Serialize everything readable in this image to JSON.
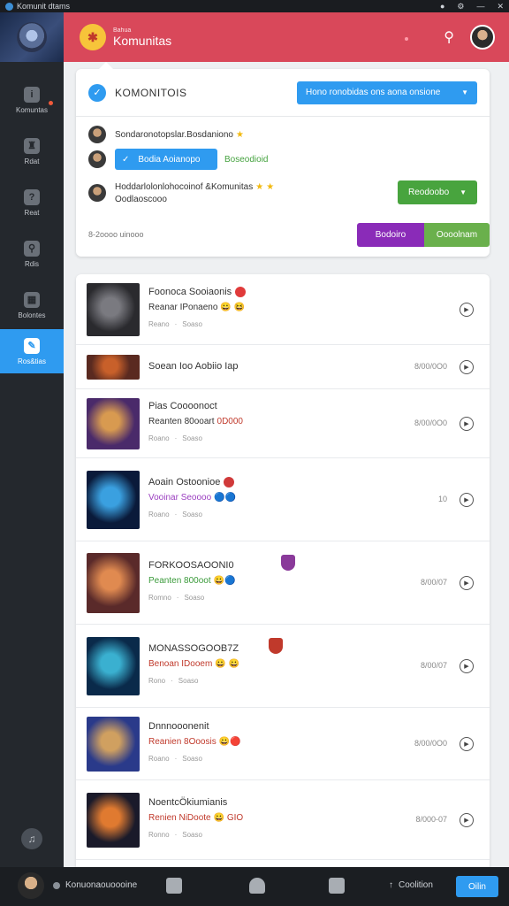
{
  "window": {
    "title": "Komunit dtams"
  },
  "sidebar": {
    "items": [
      {
        "label": "Komuntas",
        "icon": "info-icon"
      },
      {
        "label": "Rdat",
        "icon": "chess-icon"
      },
      {
        "label": "Reat",
        "icon": "question-icon"
      },
      {
        "label": "Rdis",
        "icon": "key-icon"
      },
      {
        "label": "Bolontes",
        "icon": "controller-icon"
      },
      {
        "label": "Ros&tias",
        "icon": "community-icon"
      }
    ],
    "active_index": 5
  },
  "header": {
    "subtitle": "Bahua",
    "title": "Komunitas"
  },
  "card": {
    "title": "KOMONITOIS",
    "dropdown_label": "Hono ronobidas ons aona onsione",
    "row1_text": "Sondaronotopslar.Bosdaniono",
    "chip_label": "Bodia Aoianopo",
    "chip_link": "Boseodioid",
    "row3_line1": "Hoddarlolonlohocoinof &Komunitas",
    "row3_line2": "Oodlaoscooo",
    "green_button": "Reodoobo",
    "footer_text": "8-2oooo uinooo",
    "purple_button": "Bodoiro",
    "light_green_button": "Oooolnam"
  },
  "list": {
    "items": [
      {
        "title": "Foonoca Sooiaonis",
        "subtitle": "Reanar IPonaeno",
        "sub_color": "#333333",
        "meta_left": "Reano",
        "meta_right": "Soaso",
        "right_value": "",
        "title_badge_color": "#e03a3a",
        "title_mark": "",
        "sub_mark": "😀 😆",
        "thumb_a": "#2a2a2e",
        "thumb_b": "#7a7a80"
      },
      {
        "title": "Soean Ioo Aobiio Iap",
        "subtitle": "",
        "sub_color": "#333333",
        "meta_left": "",
        "meta_right": "",
        "right_value": "8/00/0O0",
        "title_badge_color": "",
        "title_mark": "",
        "sub_mark": "",
        "thumb_a": "#5a2a20",
        "thumb_b": "#c8602a"
      },
      {
        "title": "Pias Coooonoct",
        "subtitle": "Reanten 80ooart",
        "sub_color": "#333333",
        "meta_left": "Roano",
        "meta_right": "Soaso",
        "right_value": "8/00/0O0",
        "title_badge_color": "",
        "title_mark": "",
        "sub_mark": "0D000",
        "thumb_a": "#4a2a6a",
        "thumb_b": "#d89a50"
      },
      {
        "title": "Aoain Ostoonioe",
        "subtitle": "Vooinar Seoooo",
        "sub_color": "#9b3fc0",
        "meta_left": "Roano",
        "meta_right": "Soaso",
        "right_value": "10",
        "title_badge_color": "#d03a3a",
        "title_mark": "",
        "sub_mark": "🔵🔵",
        "thumb_a": "#0a1a3a",
        "thumb_b": "#3aa0e0"
      },
      {
        "title": "FORKOOSAOONI0",
        "subtitle": "Peanten 800oot",
        "sub_color": "#3a9a3a",
        "meta_left": "Romno",
        "meta_right": "Soaso",
        "right_value": "8/00/07",
        "title_badge_color": "",
        "title_mark": "shield-purple",
        "sub_mark": "😀🔵",
        "thumb_a": "#5a2a2a",
        "thumb_b": "#e08a50"
      },
      {
        "title": "MONASSOGOOB7Z",
        "subtitle": "Benoan IDooem",
        "sub_color": "#c0392b",
        "meta_left": "Rono",
        "meta_right": "Soaso",
        "right_value": "8/00/07",
        "title_badge_color": "",
        "title_mark": "shield-red",
        "sub_mark": "😀 😀",
        "thumb_a": "#0a2a4a",
        "thumb_b": "#3ab0d0"
      },
      {
        "title": "Dnnnooonenit",
        "subtitle": "Reanien 8Ooosis",
        "sub_color": "#c0392b",
        "meta_left": "Roano",
        "meta_right": "Soaso",
        "right_value": "8/00/0O0",
        "title_badge_color": "",
        "title_mark": "",
        "sub_mark": "😀🔴",
        "thumb_a": "#2a3a8a",
        "thumb_b": "#d0a060"
      },
      {
        "title": "NoentcÖkiumianis",
        "subtitle": "Renien NiDoote",
        "sub_color": "#c0392b",
        "meta_left": "Ronno",
        "meta_right": "Soaso",
        "right_value": "8/000-07",
        "title_badge_color": "",
        "title_mark": "",
        "sub_mark": "😀 GIO",
        "thumb_a": "#1a1a2a",
        "thumb_b": "#e07a30"
      }
    ]
  },
  "bottombar": {
    "username": "Konuonaouoooine",
    "link_label": "Coolition",
    "button_label": "Oilin"
  },
  "colors": {
    "accent": "#2f9bf0",
    "header": "#d9485a",
    "green": "#48a43e",
    "purple": "#8a2bb8"
  }
}
